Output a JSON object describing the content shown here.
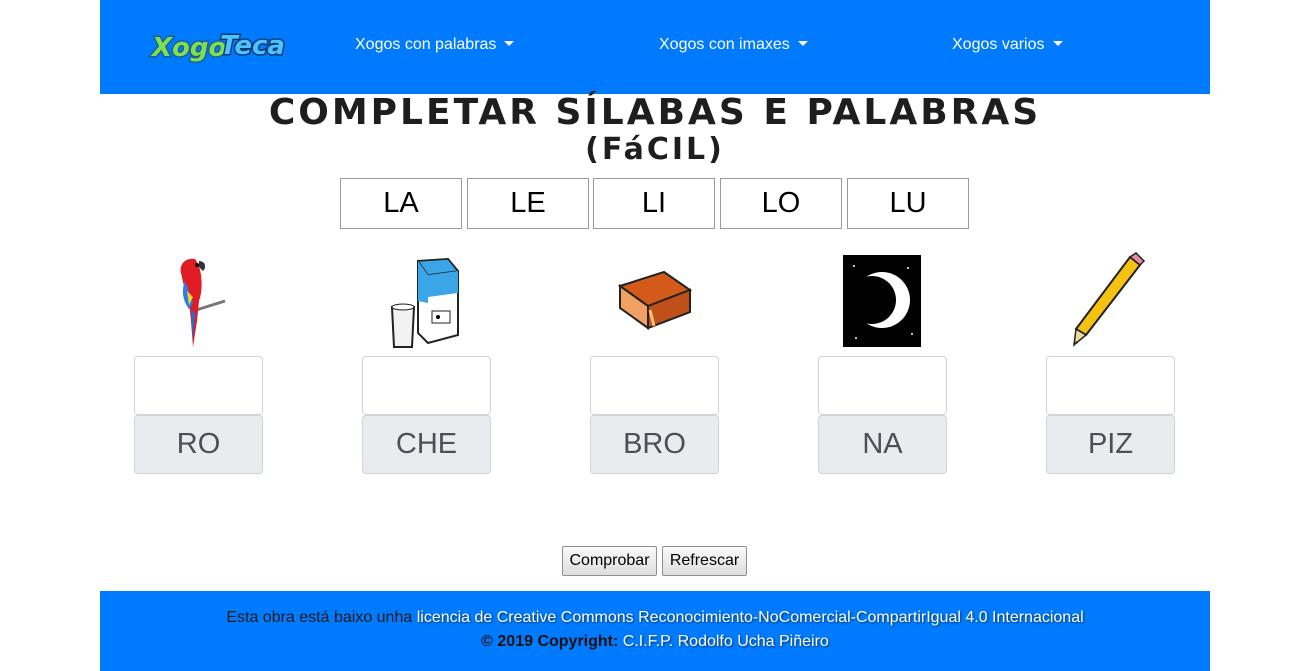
{
  "navbar": {
    "logo_text": "XogoTeca",
    "menu": [
      {
        "label": "Xogos con palabras"
      },
      {
        "label": "Xogos con imaxes"
      },
      {
        "label": "Xogos varios"
      }
    ]
  },
  "title": {
    "line1": "COMPLETAR SÍLABAS E PALABRAS",
    "line2": "(FáCIL)"
  },
  "syllables": [
    "LA",
    "LE",
    "LI",
    "LO",
    "LU"
  ],
  "cards": [
    {
      "image": "parrot-image",
      "suffix": "RO"
    },
    {
      "image": "milk-carton-image",
      "suffix": "CHE"
    },
    {
      "image": "book-image",
      "suffix": "BRO"
    },
    {
      "image": "moon-image",
      "suffix": "NA"
    },
    {
      "image": "pencil-image",
      "suffix": "PIZ"
    }
  ],
  "buttons": {
    "check": "Comprobar",
    "refresh": "Refrescar"
  },
  "footer": {
    "prefix": "Esta obra está baixo unha",
    "license_link": "licencia de Creative Commons Reconocimiento-NoComercial-CompartirIgual 4.0 Internacional",
    "copyright_prefix": "© 2019 Copyright:",
    "copyright_name": "C.I.F.P. Rodolfo Ucha Piñeiro"
  },
  "colors": {
    "primary": "#007bff",
    "addon_bg": "#e9ecef"
  }
}
